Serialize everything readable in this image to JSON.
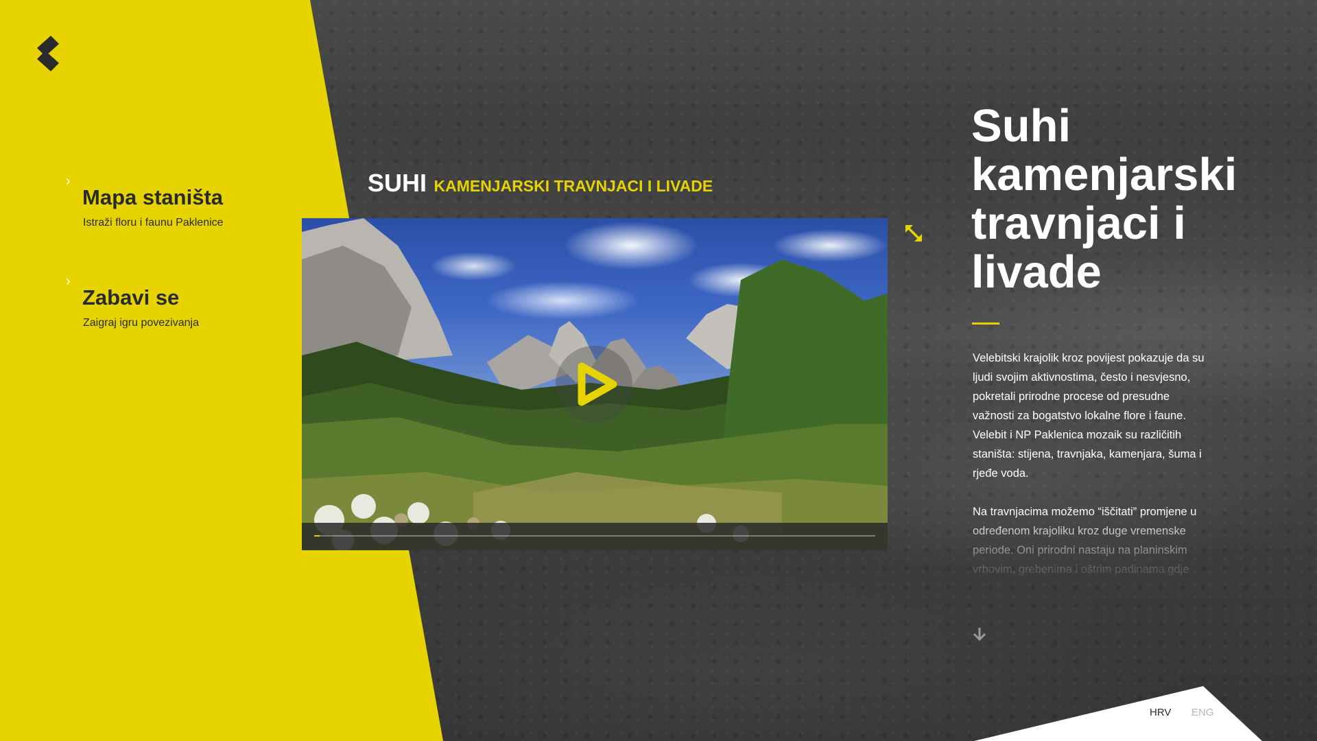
{
  "brand": {
    "logo_icon": "paklenica-logo-icon",
    "accent_color": "#e6d300"
  },
  "nav": {
    "items": [
      {
        "title": "Mapa staništa",
        "subtitle": "Istraži floru i faunu Paklenice",
        "icon": "chevron-right-icon"
      },
      {
        "title": "Zabavi se",
        "subtitle": "Zaigraj igru povezivanja",
        "icon": "chevron-right-icon"
      }
    ]
  },
  "video": {
    "heading_main": "SUHI",
    "heading_sub": "KAMENJARSKI TRAVNJACI I LIVADE",
    "play_icon": "play-icon",
    "expand_icon": "expand-icon",
    "progress": 0.01
  },
  "article": {
    "title": "Suhi kamenjarski travnjaci i livade",
    "paragraphs": [
      "Velebitski krajolik kroz povijest pokazuje da su ljudi svojim aktivnostima, često i nesvjesno, pokretali prirodne procese od presudne važnosti za bogatstvo lokalne flore i faune. Velebit i NP Paklenica mozaik su različitih staništa: stijena, travnjaka, kamenjara, šuma i rjeđe voda.",
      "Na travnjacima možemo “iščitati” promjene u određenom krajoliku kroz duge vremenske periode. Oni prirodni nastaju na planinskim vrhovim, grebenima i oštrim padinama gdje snijeg, lavina i bura priječe razvoj šumske vegetacije. Dopirodni"
    ],
    "scroll_icon": "arrow-down-icon"
  },
  "language": {
    "active": "HRV",
    "inactive": "ENG"
  }
}
